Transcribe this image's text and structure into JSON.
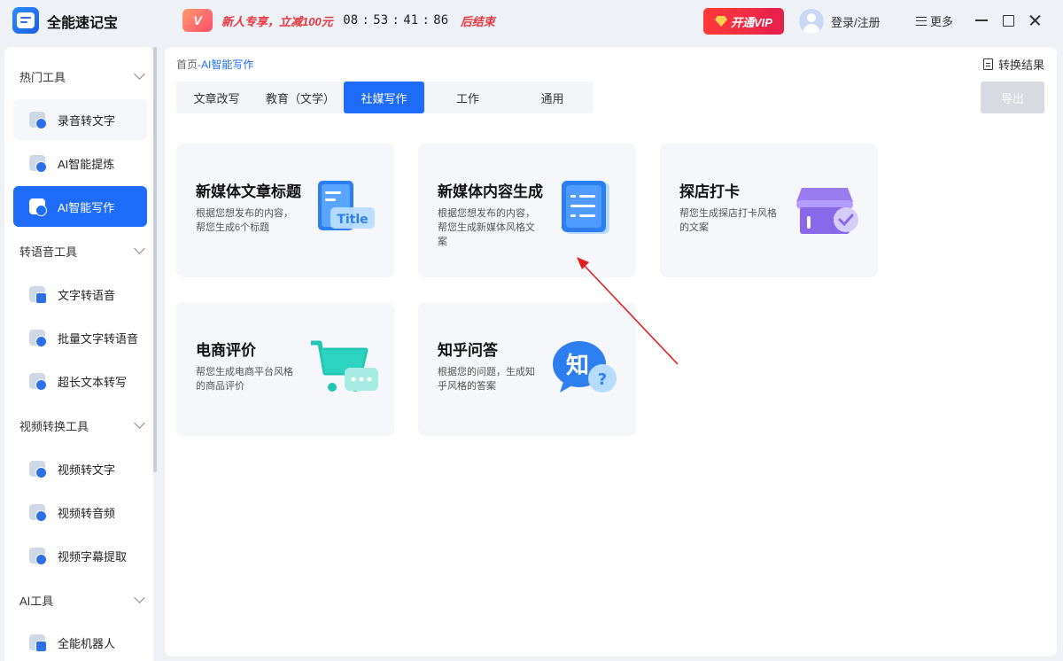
{
  "app": {
    "title": "全能速记宝",
    "promo": {
      "badge": "V",
      "text": "新人专享，立减100元",
      "countdown": [
        "08",
        "53",
        "41",
        "86"
      ],
      "suffix": "后结束"
    },
    "vip_label": "开通VIP",
    "login_label": "登录/注册",
    "more_label": "更多"
  },
  "sidebar": {
    "groups": [
      {
        "label": "热门工具",
        "items": [
          "录音转文字",
          "AI智能提炼",
          "AI智能写作"
        ]
      },
      {
        "label": "转语音工具",
        "items": [
          "文字转语音",
          "批量文字转语音",
          "超长文本转写"
        ]
      },
      {
        "label": "视频转换工具",
        "items": [
          "视频转文字",
          "视频转音频",
          "视频字幕提取"
        ]
      },
      {
        "label": "AI工具",
        "items": [
          "全能机器人"
        ]
      }
    ],
    "active_item": "AI智能写作"
  },
  "main": {
    "breadcrumb": {
      "home": "首页",
      "sep": "-",
      "current": "AI智能写作"
    },
    "result_label": "转换结果",
    "export_label": "导出",
    "tabs": [
      "文章改写",
      "教育（文学）",
      "社媒写作",
      "工作",
      "通用"
    ],
    "active_tab": "社媒写作",
    "cards": [
      {
        "title": "新媒体文章标题",
        "desc": "根据您想发布的内容，帮您生成6个标题",
        "icon": "title-doc-icon",
        "icon_text": "Title"
      },
      {
        "title": "新媒体内容生成",
        "desc": "根据您想发布的内容，帮您生成新媒体风格文案",
        "icon": "content-doc-icon"
      },
      {
        "title": "探店打卡",
        "desc": "帮您生成探店打卡风格的文案",
        "icon": "store-check-icon"
      },
      {
        "title": "电商评价",
        "desc": "帮您生成电商平台风格的商品评价",
        "icon": "cart-chat-icon"
      },
      {
        "title": "知乎问答",
        "desc": "根据您的问题，生成知乎风格的答案",
        "icon": "zhihu-qa-icon",
        "icon_text": "知"
      }
    ]
  },
  "colors": {
    "accent": "#1f6bfa",
    "promo_red": "#e8363f",
    "annotation_arrow": "#e02020"
  }
}
